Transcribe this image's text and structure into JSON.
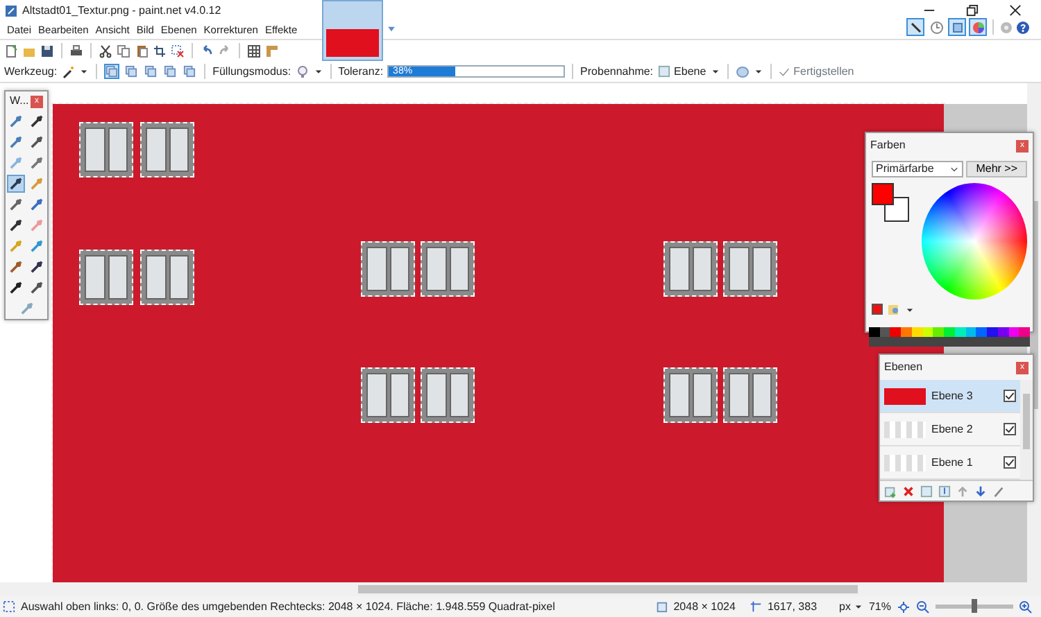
{
  "window": {
    "title": "Altstadt01_Textur.png - paint.net v4.0.12"
  },
  "menu": [
    "Datei",
    "Bearbeiten",
    "Ansicht",
    "Bild",
    "Ebenen",
    "Korrekturen",
    "Effekte"
  ],
  "image_tabs": [
    {
      "selected": true
    }
  ],
  "panel_toggles": [
    {
      "on": true
    },
    {
      "on": false
    },
    {
      "on": true
    },
    {
      "on": true
    }
  ],
  "toolbar": {
    "tool_label": "Werkzeug:",
    "selection_modes": [
      {
        "selected": true
      },
      {
        "selected": false
      },
      {
        "selected": false
      },
      {
        "selected": false
      },
      {
        "selected": false
      }
    ],
    "fill_label": "Füllungsmodus:",
    "tolerance_label": "Toleranz:",
    "tolerance": {
      "reading": "38%",
      "level": 0.38
    },
    "sampling_label": "Probennahme:",
    "sampling_value": "Ebene",
    "finish": "Fertigstellen"
  },
  "tools_window": {
    "title": "W...",
    "close": "x",
    "tools": [
      {
        "selected": false
      },
      {
        "selected": false
      },
      {
        "selected": false
      },
      {
        "selected": false
      },
      {
        "selected": false
      },
      {
        "selected": false
      },
      {
        "selected": true
      },
      {
        "selected": false
      },
      {
        "selected": false
      },
      {
        "selected": false
      },
      {
        "selected": false
      },
      {
        "selected": false
      },
      {
        "selected": false
      },
      {
        "selected": false
      },
      {
        "selected": false
      },
      {
        "selected": false
      },
      {
        "selected": false
      },
      {
        "selected": false
      },
      {
        "selected": false
      }
    ]
  },
  "colors_panel": {
    "title": "Farben",
    "close": "x",
    "dropdown": "Primärfarbe",
    "more_button": "Mehr >>",
    "swatches": [
      {
        "kind": "secondary",
        "color": "#ffffff"
      },
      {
        "kind": "primary",
        "color": "#ff0000"
      }
    ]
  },
  "layers_panel": {
    "title": "Ebenen",
    "close": "x",
    "layers": [
      {
        "name": "Ebene 3",
        "visible": true,
        "selected": true
      },
      {
        "name": "Ebene 2",
        "visible": true,
        "selected": false
      },
      {
        "name": "Ebene 1",
        "visible": true,
        "selected": false
      }
    ]
  },
  "status_bar": {
    "selection_info": "Auswahl oben links: 0, 0. Größe des umgebenden Rechtecks: 2048 × 1024. Fläche: 1.948.559 Quadrat-pixel",
    "image_size": "2048 × 1024",
    "cursor_position": "1617, 383",
    "unit": "px",
    "zoom": "71%",
    "zoom_level": {
      "level": 0.5
    }
  }
}
